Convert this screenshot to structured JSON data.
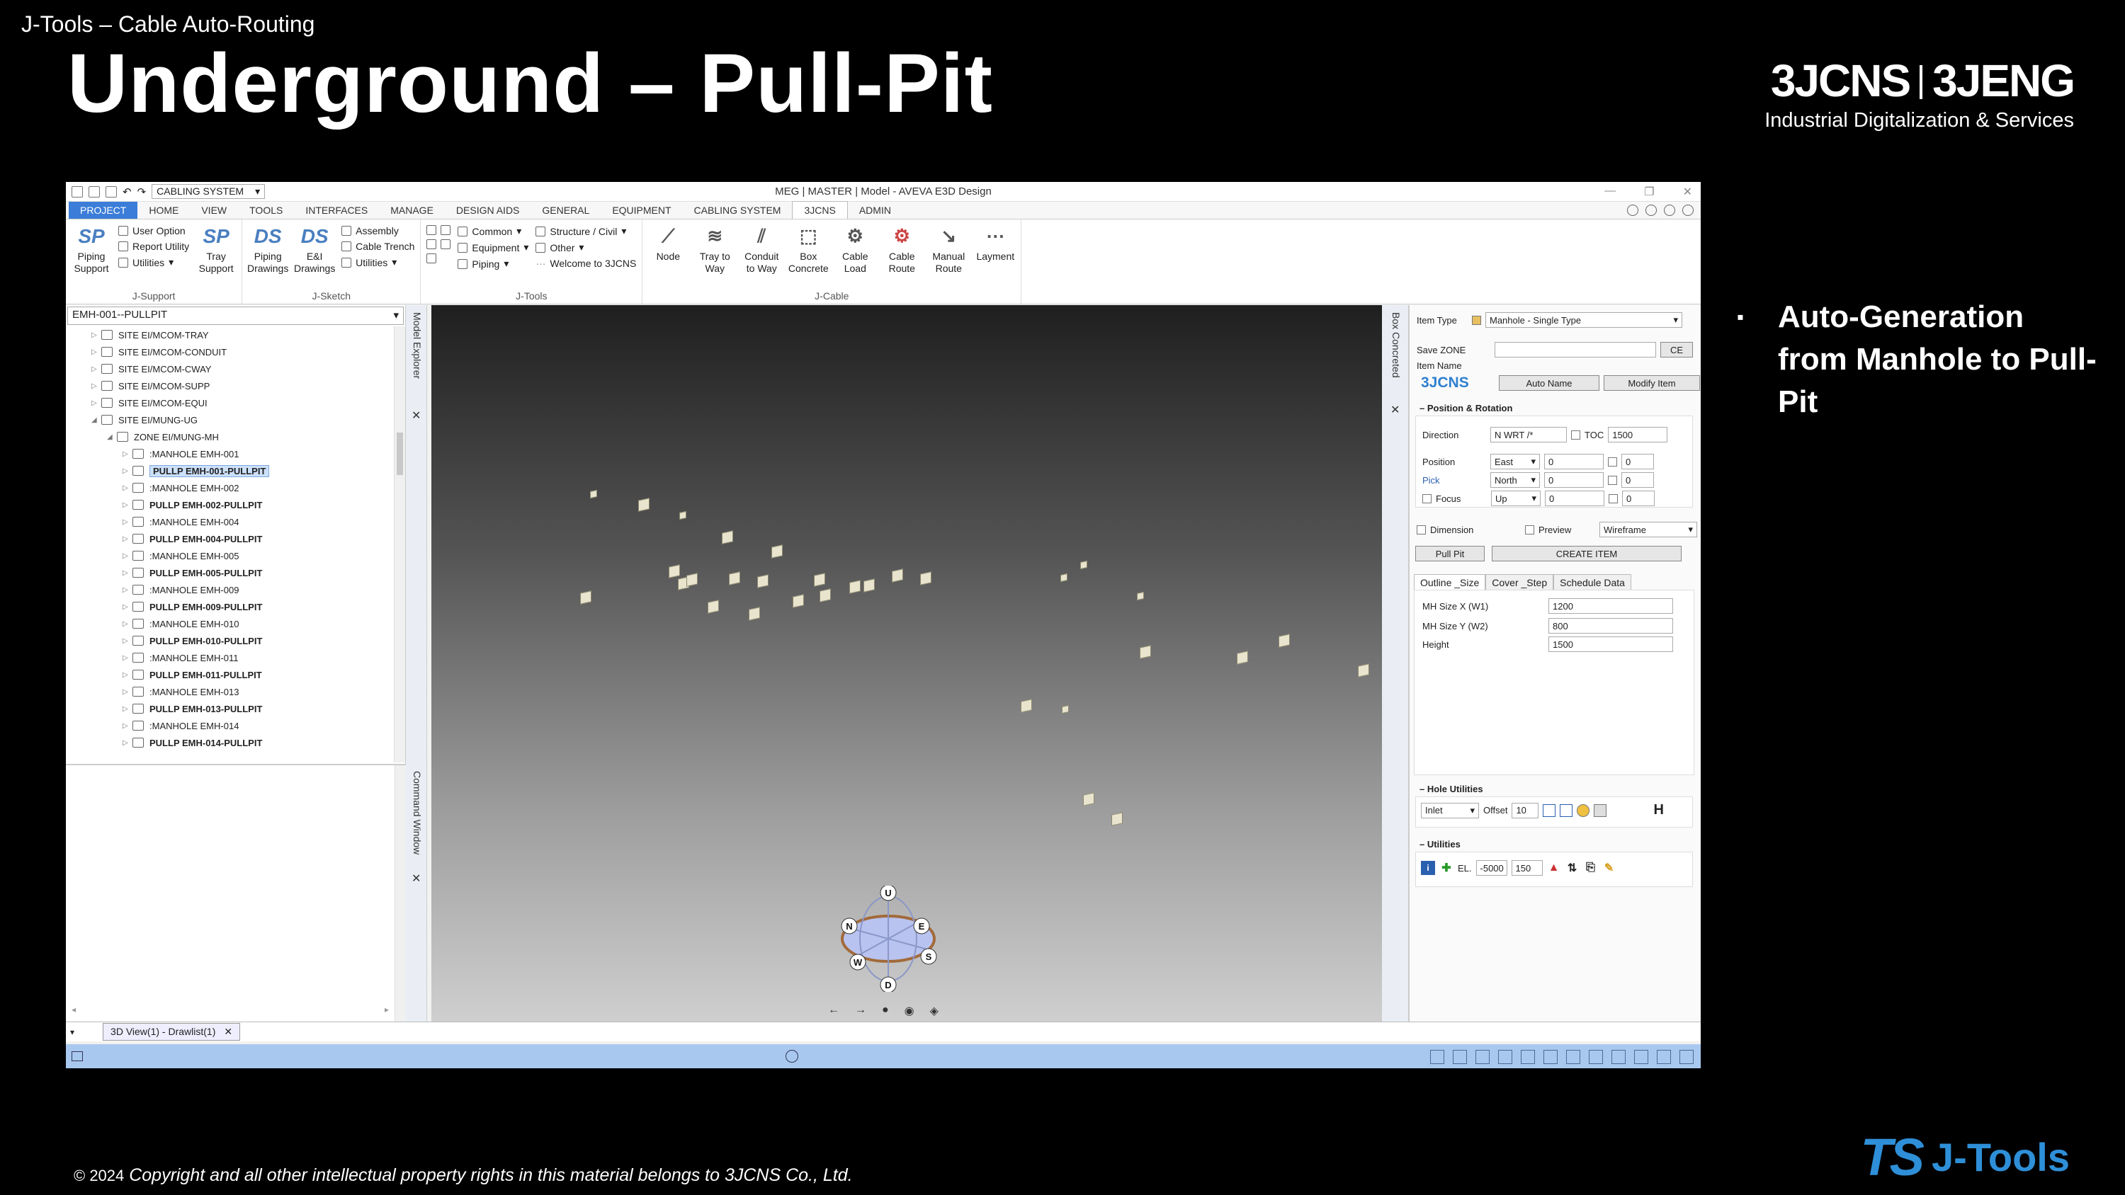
{
  "slide": {
    "subtitle": "J-Tools – Cable Auto-Routing",
    "title": "Underground – Pull-Pit",
    "logo_left": "3JCNS",
    "logo_right": "3JENG",
    "logo_tagline": "Industrial Digitalization & Services",
    "bullet_mark": "▪",
    "bullet_line1": "Auto-Generation",
    "bullet_line2": "from Manhole to Pull-Pit",
    "copyright_symbol": "© 2024",
    "copyright_text": "Copyright and all other intellectual property rights in this material belongs to 3JCNS Co., Ltd.",
    "jtools_ts": "TS",
    "jtools_name": "J-Tools"
  },
  "window": {
    "title": "MEG | MASTER | Model - AVEVA E3D Design",
    "qat_combo": "CABLING SYSTEM"
  },
  "tabs": [
    "PROJECT",
    "HOME",
    "VIEW",
    "TOOLS",
    "INTERFACES",
    "MANAGE",
    "DESIGN AIDS",
    "GENERAL",
    "EQUIPMENT",
    "CABLING SYSTEM",
    "3JCNS",
    "ADMIN"
  ],
  "ribbon": {
    "jsupport": {
      "label": "J-Support",
      "piping_support": "Piping Support",
      "user_option": "User Option",
      "report_utility": "Report Utility",
      "utilities": "Utilities",
      "tray_support": "Tray Support"
    },
    "jsketch": {
      "label": "J-Sketch",
      "piping_drawings": "Piping Drawings",
      "ei_drawings": "E&I Drawings",
      "assembly": "Assembly",
      "cable_trench": "Cable Trench",
      "utilities": "Utilities"
    },
    "jtools": {
      "label": "J-Tools",
      "common": "Common",
      "equipment": "Equipment",
      "piping": "Piping",
      "structure": "Structure / Civil",
      "other": "Other",
      "welcome": "Welcome to 3JCNS"
    },
    "jcable": {
      "label": "J-Cable",
      "node": "Node",
      "tray_to_way": "Tray to Way",
      "conduit_to_way": "Conduit to Way",
      "box_concrete": "Box Concrete",
      "cable_load": "Cable Load",
      "cable_route": "Cable Route",
      "manual_route": "Manual Route",
      "layment": "Layment"
    }
  },
  "tree": {
    "combo": "EMH-001--PULLPIT",
    "rows": [
      {
        "label": "SITE EI/MCOM-TRAY"
      },
      {
        "label": "SITE EI/MCOM-CONDUIT"
      },
      {
        "label": "SITE EI/MCOM-CWAY"
      },
      {
        "label": "SITE EI/MCOM-SUPP"
      },
      {
        "label": "SITE EI/MCOM-EQUI"
      },
      {
        "label": "SITE EI/MUNG-UG"
      },
      {
        "label": "ZONE EI/MUNG-MH"
      },
      {
        "label": ":MANHOLE EMH-001"
      },
      {
        "label": "PULLP EMH-001-PULLPIT"
      },
      {
        "label": ":MANHOLE EMH-002"
      },
      {
        "label": "PULLP EMH-002-PULLPIT"
      },
      {
        "label": ":MANHOLE EMH-004"
      },
      {
        "label": "PULLP EMH-004-PULLPIT"
      },
      {
        "label": ":MANHOLE EMH-005"
      },
      {
        "label": "PULLP EMH-005-PULLPIT"
      },
      {
        "label": ":MANHOLE EMH-009"
      },
      {
        "label": "PULLP EMH-009-PULLPIT"
      },
      {
        "label": ":MANHOLE EMH-010"
      },
      {
        "label": "PULLP EMH-010-PULLPIT"
      },
      {
        "label": ":MANHOLE EMH-011"
      },
      {
        "label": "PULLP EMH-011-PULLPIT"
      },
      {
        "label": ":MANHOLE EMH-013"
      },
      {
        "label": "PULLP EMH-013-PULLPIT"
      },
      {
        "label": ":MANHOLE EMH-014"
      },
      {
        "label": "PULLP EMH-014-PULLPIT"
      }
    ]
  },
  "side_tabs": {
    "model_explorer": "Model Explorer",
    "command_window": "Command Window",
    "box_concreted": "Box Concreted"
  },
  "gizmo": {
    "u": "U",
    "d": "D",
    "n": "N",
    "e": "E",
    "w": "W",
    "s": "S"
  },
  "form": {
    "item_type_label": "Item Type",
    "item_type_value": "Manhole - Single Type",
    "save_zone_label": "Save ZONE",
    "ce_button": "CE",
    "item_name_label": "Item Name",
    "logo": "3JCNS",
    "auto_name_button": "Auto Name",
    "modify_item_button": "Modify Item",
    "pos_rot_section": "Position & Rotation",
    "direction_label": "Direction",
    "direction_value": "N WRT /*",
    "toc_label": "TOC",
    "toc_value": "1500",
    "position_label": "Position",
    "pick_label": "Pick",
    "focus_label": "Focus",
    "east": "East",
    "north": "North",
    "up": "Up",
    "pos_values": [
      "0",
      "0",
      "0"
    ],
    "pos_values2": [
      "0",
      "0",
      "0"
    ],
    "dimension_label": "Dimension",
    "preview_label": "Preview",
    "view_mode": "Wireframe",
    "pull_pit_button": "Pull Pit",
    "create_item_button": "CREATE ITEM",
    "subtabs": [
      "Outline _Size",
      "Cover _Step",
      "Schedule Data"
    ],
    "mh_x_label": "MH Size X (W1)",
    "mh_x_value": "1200",
    "mh_y_label": "MH Size Y (W2)",
    "mh_y_value": "800",
    "height_label": "Height",
    "height_value": "1500",
    "hole_section": "Hole Utilities",
    "inlet_value": "Inlet",
    "offset_label": "Offset",
    "offset_value": "10",
    "h_label": "H",
    "utilities_section": "Utilities",
    "el_label": "EL.",
    "el_value": "-5000",
    "el_value2": "150"
  },
  "doc_tab": {
    "label": "3D View(1) - Drawlist(1)",
    "close": "✕"
  }
}
